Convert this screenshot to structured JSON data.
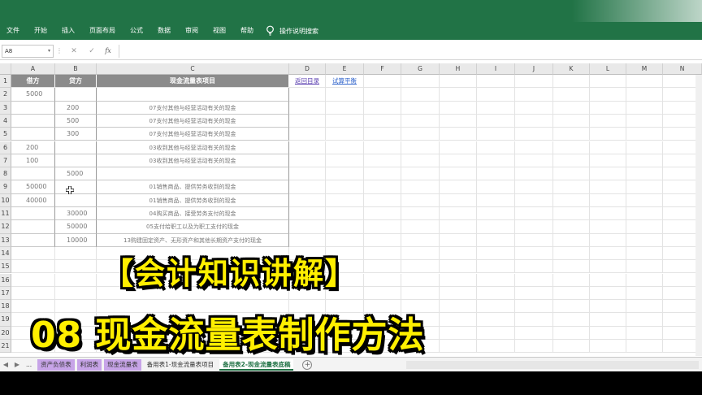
{
  "ribbon": {
    "tabs": [
      "文件",
      "开始",
      "插入",
      "页面布局",
      "公式",
      "数据",
      "审阅",
      "视图",
      "帮助"
    ],
    "tell_me": "操作说明搜索"
  },
  "formula_bar": {
    "name_box": "A8",
    "fx": "fx",
    "value": ""
  },
  "columns": [
    "A",
    "B",
    "C",
    "D",
    "E",
    "F",
    "G",
    "H",
    "I",
    "J",
    "K",
    "L",
    "M",
    "N"
  ],
  "rows": [
    "1",
    "2",
    "3",
    "4",
    "5",
    "6",
    "7",
    "8",
    "9",
    "10",
    "11",
    "12",
    "13",
    "14",
    "15",
    "16",
    "17",
    "18",
    "19",
    "20",
    "21"
  ],
  "header_row": {
    "a": "借方",
    "b": "贷方",
    "c": "现金流量表项目"
  },
  "links": {
    "d1": "返回目录",
    "e1": "试算平衡"
  },
  "table": [
    {
      "a": "5000",
      "b": "",
      "c": ""
    },
    {
      "a": "",
      "b": "200",
      "c": "07支付其他与经营活动有关的现金"
    },
    {
      "a": "",
      "b": "500",
      "c": "07支付其他与经营活动有关的现金"
    },
    {
      "a": "",
      "b": "300",
      "c": "07支付其他与经营活动有关的现金"
    },
    {
      "a": "200",
      "b": "",
      "c": "03收到其他与经营活动有关的现金"
    },
    {
      "a": "100",
      "b": "",
      "c": "03收到其他与经营活动有关的现金"
    },
    {
      "a": "",
      "b": "5000",
      "c": ""
    },
    {
      "a": "50000",
      "b": "",
      "c": "01销售商品、提供劳务收到的现金"
    },
    {
      "a": "40000",
      "b": "",
      "c": "01销售商品、提供劳务收到的现金"
    },
    {
      "a": "",
      "b": "30000",
      "c": "04购买商品、接受劳务支付的现金"
    },
    {
      "a": "",
      "b": "50000",
      "c": "05支付给职工以及为职工支付的现金"
    },
    {
      "a": "",
      "b": "10000",
      "c": "13购建固定资产、无形资产和其他长期资产支付的现金"
    }
  ],
  "sheet_tabs": {
    "ellipsis": "...",
    "items": [
      {
        "label": "资产负债表",
        "style": "purple"
      },
      {
        "label": "利润表",
        "style": "purple"
      },
      {
        "label": "现金流量表",
        "style": "purple"
      },
      {
        "label": "备用表1-现金流量表项目",
        "style": "plain"
      },
      {
        "label": "备用表2-现金流量表底稿",
        "style": "active"
      }
    ],
    "add": "+"
  },
  "captions": {
    "line1": "【会计知识讲解】",
    "line2": "08 现金流量表制作方法"
  },
  "colors": {
    "ribbon": "#217346",
    "caption": "#ffef00",
    "header_fill": "#8b8b8b",
    "tab_purple": "#c7a4e8"
  },
  "icons": [
    "lightbulb-icon",
    "name-box-dropdown-icon",
    "cancel-icon",
    "confirm-icon",
    "fx-icon",
    "cell-cursor-icon",
    "prev-sheet-icon",
    "next-sheet-icon",
    "add-sheet-icon"
  ]
}
